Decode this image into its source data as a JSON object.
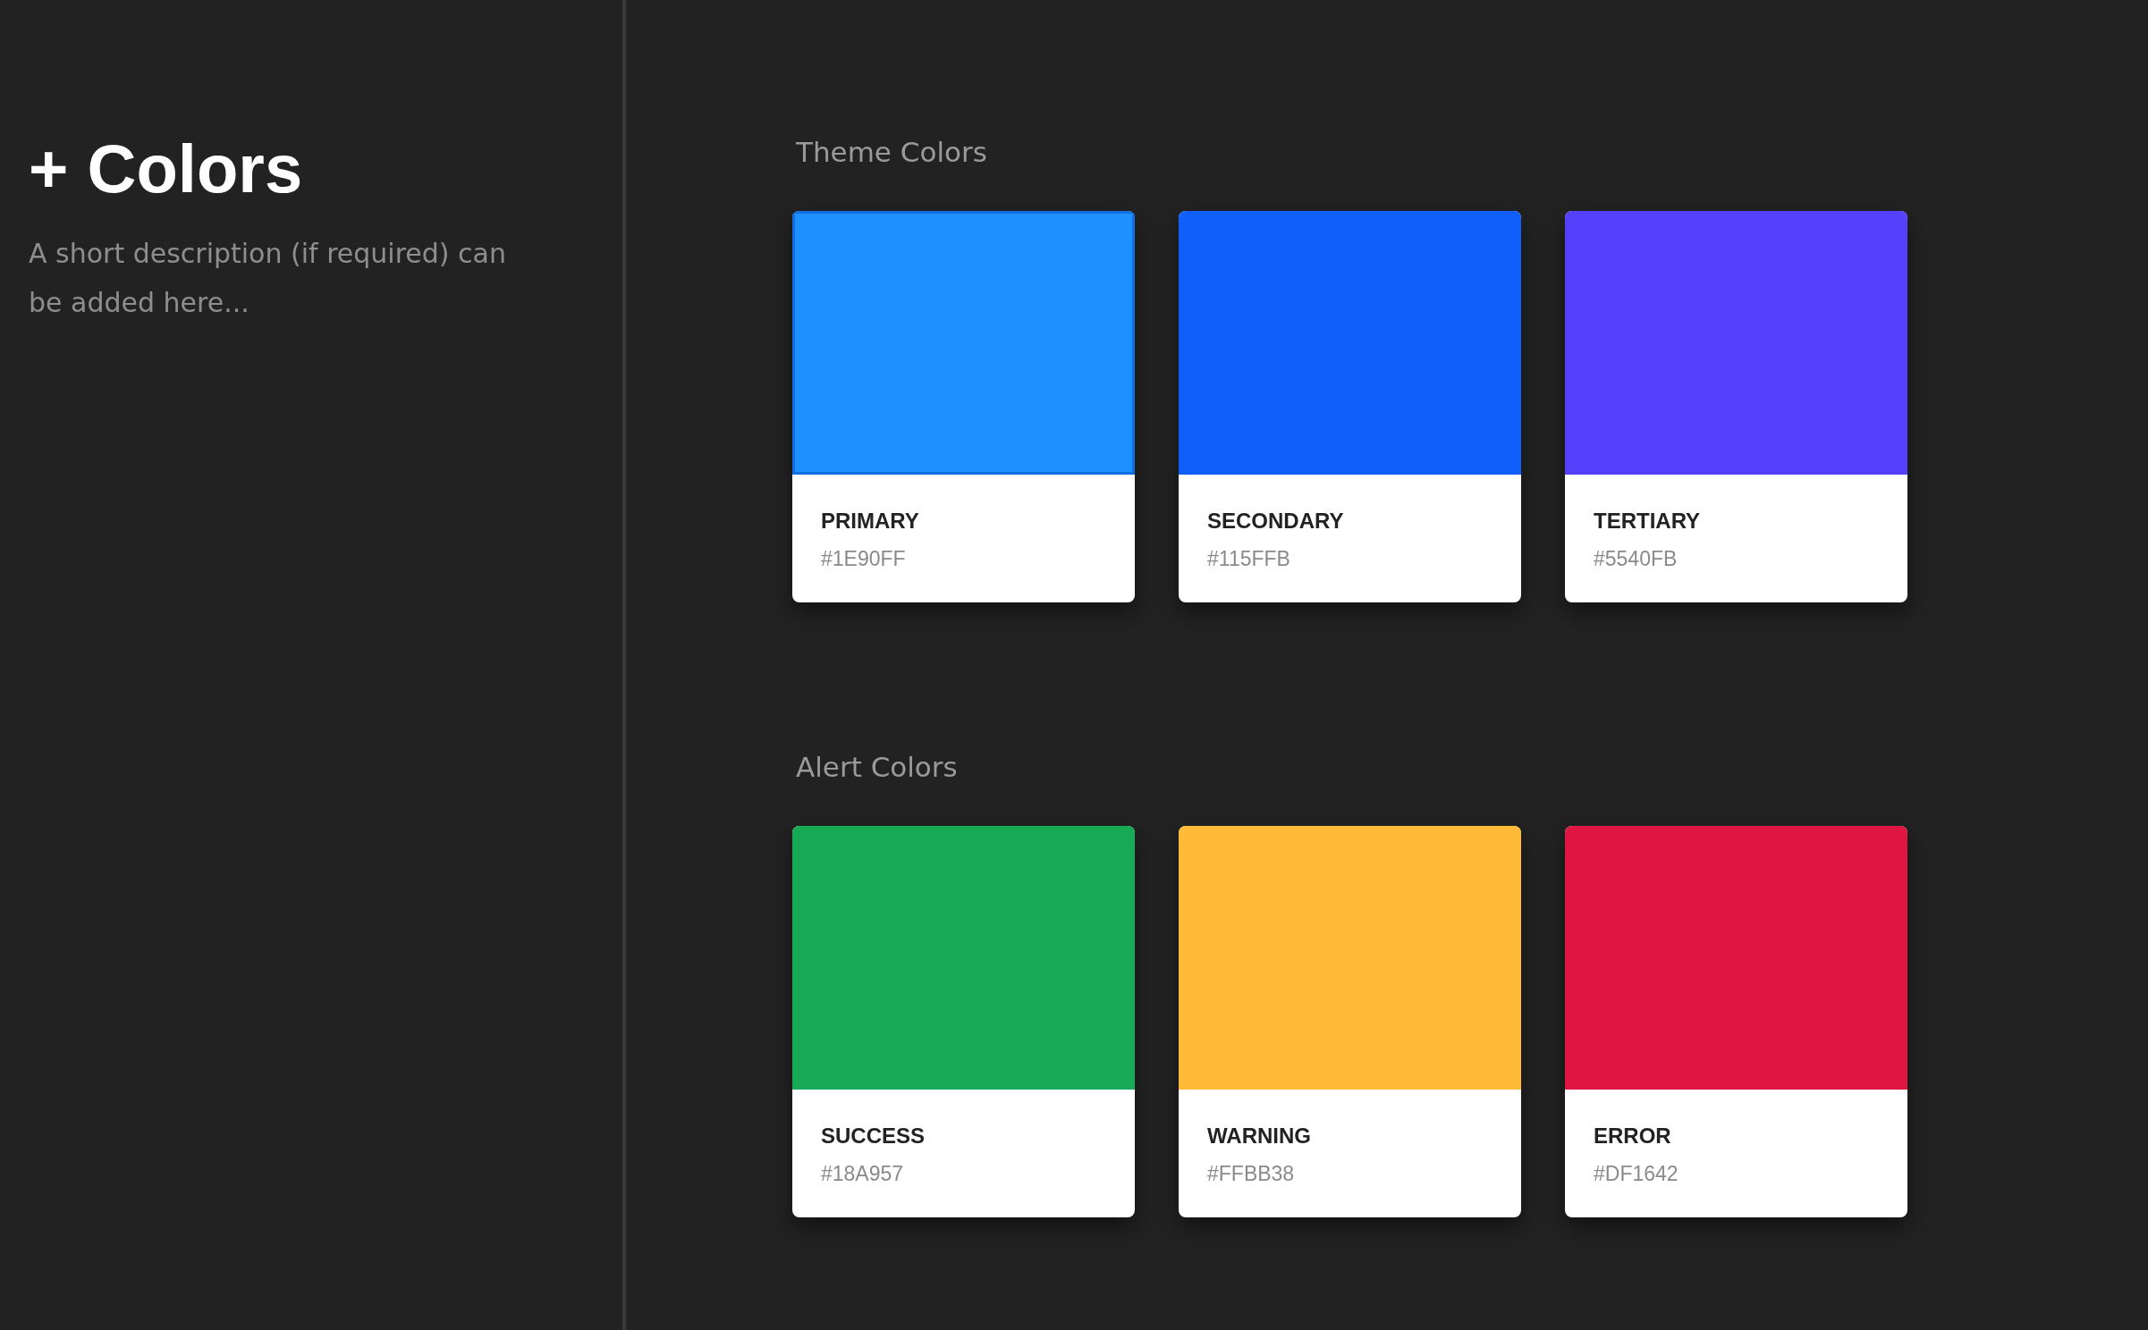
{
  "sidebar": {
    "title": "+ Colors",
    "description": "A short description (if required) can be added here..."
  },
  "sections": [
    {
      "title": "Theme Colors",
      "swatches": [
        {
          "name": "PRIMARY",
          "hex": "#1E90FF",
          "color": "#1e90ff",
          "selected": true
        },
        {
          "name": "SECONDARY",
          "hex": "#115FFB",
          "color": "#115ffb",
          "selected": false
        },
        {
          "name": "TERTIARY",
          "hex": "#5540FB",
          "color": "#5540fb",
          "selected": false
        }
      ]
    },
    {
      "title": "Alert Colors",
      "swatches": [
        {
          "name": "SUCCESS",
          "hex": "#18A957",
          "color": "#18a957",
          "selected": false
        },
        {
          "name": "WARNING",
          "hex": "#FFBB38",
          "color": "#ffbb38",
          "selected": false
        },
        {
          "name": "ERROR",
          "hex": "#DF1642",
          "color": "#df1642",
          "selected": false
        }
      ]
    }
  ]
}
